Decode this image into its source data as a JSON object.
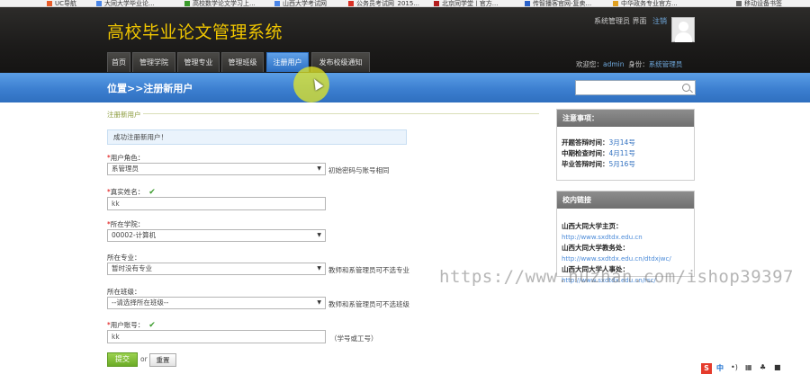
{
  "bookmarks": [
    {
      "label": "UC导航",
      "color": "#e85d2a"
    },
    {
      "label": "大同大学毕业论...",
      "color": "#4a86e8"
    },
    {
      "label": "高校数学论文学习上...",
      "color": "#3a9b2b"
    },
    {
      "label": "山西大学考试网",
      "color": "#4a86e8"
    },
    {
      "label": "公务员考试网_2015...",
      "color": "#d93025"
    },
    {
      "label": "北京同学堂 | 官方...",
      "color": "#b31d1d"
    },
    {
      "label": "传智播客官网-复卖...",
      "color": "#2a62c9"
    },
    {
      "label": "中华政务专业官方...",
      "color": "#e0a020"
    },
    {
      "label": "移动设备书签",
      "color": "#6a6a6a"
    }
  ],
  "header": {
    "title": "高校毕业论文管理系统",
    "user_area": "系统管理员 界面",
    "logout": "注销",
    "welcome_label": "欢迎您：",
    "username": "admin",
    "role_label": "身份：",
    "role": "系统管理员"
  },
  "nav": {
    "tabs": [
      "首页",
      "管理学院",
      "管理专业",
      "管理班级",
      "注册用户",
      "发布校级通知"
    ],
    "active_index": 4
  },
  "location": {
    "text": "位置>>注册新用户",
    "search_placeholder": ""
  },
  "form": {
    "section_title": "注册新用户",
    "info": "成功注册新用户！",
    "role_label": "用户角色：",
    "role_value": "系管理员",
    "role_hint": "初始密码与账号相同",
    "name_label": "真实姓名：",
    "name_value": "kk",
    "college_label": "所在学院：",
    "college_value": "00002-计算机",
    "major_label": "所在专业：",
    "major_value": "暂时没有专业",
    "major_hint": "教师和系管理员可不选专业",
    "class_label": "所在班级：",
    "class_value": "--请选择所在班级--",
    "class_hint": "教师和系管理员可不选班级",
    "account_label": "用户账号：",
    "account_value": "kk",
    "account_hint": "（学号或工号）",
    "submit": "提交",
    "or": "or",
    "reset": "重置"
  },
  "notice_panel": {
    "title": "注意事项：",
    "items": [
      {
        "label": "开题答辩时间：",
        "value": "3月14号"
      },
      {
        "label": "中期检查时间：",
        "value": "4月11号"
      },
      {
        "label": "毕业答辩时间：",
        "value": "5月16号"
      }
    ]
  },
  "links_panel": {
    "title": "校内链接",
    "items": [
      {
        "label": "山西大同大学主页：",
        "url": "http://www.sxdtdx.edu.cn"
      },
      {
        "label": "山西大同大学教务处：",
        "url": "http://www.sxdtdx.edu.cn/dtdxjwc/"
      },
      {
        "label": "山西大同大学人事处：",
        "url": "http://www.sxdtdx.edu.cn/rsc/"
      }
    ]
  },
  "watermark": "https://www.huzhan.com/ishop39397",
  "tray": {
    "items": [
      "S",
      "中",
      "•)",
      "▦",
      "♣",
      "■"
    ]
  }
}
